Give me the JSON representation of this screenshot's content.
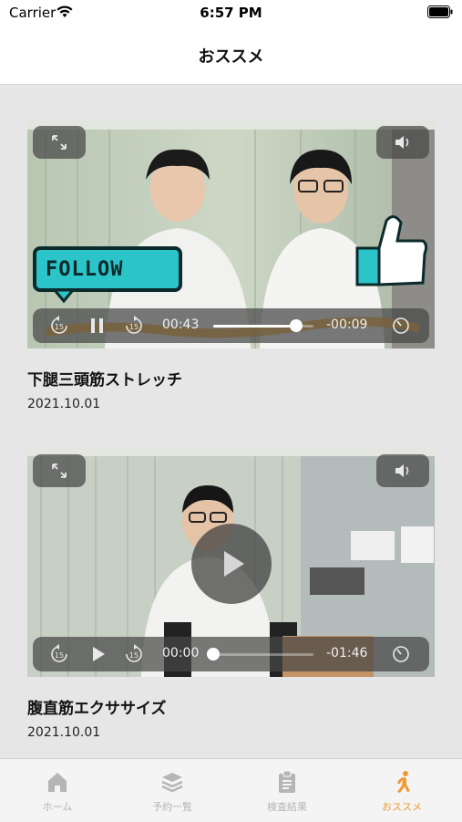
{
  "status_bar": {
    "carrier": "Carrier",
    "time": "6:57 PM"
  },
  "nav": {
    "title": "おススメ"
  },
  "videos": [
    {
      "title": "下腿三頭筋ストレッチ",
      "date": "2021.10.01",
      "elapsed": "00:43",
      "remaining": "-00:09",
      "progress": 0.83,
      "state": "playing",
      "overlay_text": "FOLLOW"
    },
    {
      "title": "腹直筋エクササイズ",
      "date": "2021.10.01",
      "elapsed": "00:00",
      "remaining": "-01:46",
      "progress": 0.0,
      "state": "paused"
    }
  ],
  "tabs": [
    {
      "label": "ホーム",
      "icon": "home-icon",
      "active": false
    },
    {
      "label": "予約一覧",
      "icon": "layers-icon",
      "active": false
    },
    {
      "label": "検査結果",
      "icon": "clipboard-icon",
      "active": false
    },
    {
      "label": "おススメ",
      "icon": "runner-icon",
      "active": true
    }
  ],
  "colors": {
    "accent": "#f09a2e",
    "inactive": "#b5b5b5"
  }
}
